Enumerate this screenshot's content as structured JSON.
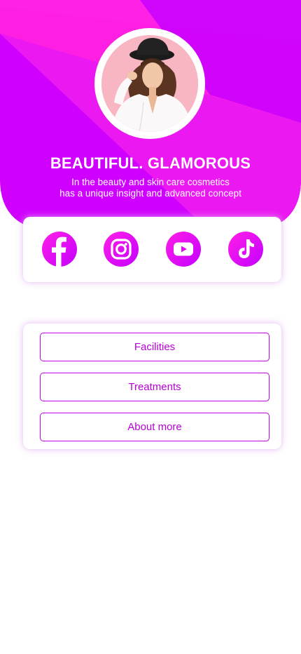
{
  "hero": {
    "headline": "BEAUTIFUL. GLAMOROUS",
    "tagline_line1": "In the beauty and skin care cosmetics",
    "tagline_line2": "has a unique insight and advanced concept",
    "gradient_colors": [
      "#ff1fe6",
      "#c400ff"
    ]
  },
  "social": {
    "items": [
      {
        "icon": "facebook-icon"
      },
      {
        "icon": "instagram-icon"
      },
      {
        "icon": "youtube-icon"
      },
      {
        "icon": "tiktok-icon"
      }
    ]
  },
  "links": {
    "items": [
      {
        "label": "Facilities"
      },
      {
        "label": "Treatments"
      },
      {
        "label": "About more"
      }
    ],
    "border_color": "#c400e8",
    "text_color": "#b800d8"
  }
}
